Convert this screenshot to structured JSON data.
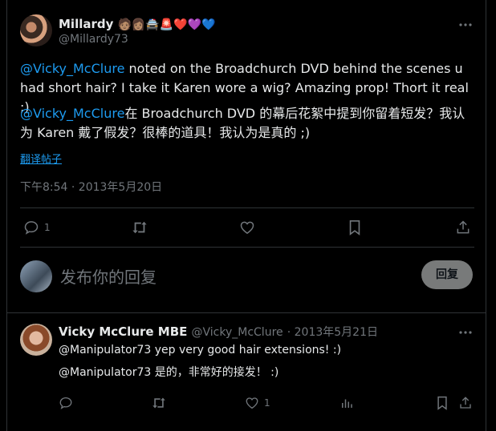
{
  "colors": {
    "background": "#000000",
    "text": "#e7e9ea",
    "muted": "#71767b",
    "accent": "#1d9bf0",
    "divider": "#2f3336"
  },
  "main_tweet": {
    "display_name": "Millardy",
    "name_emojis": "🧑🏽👩🏽🚔🚨❤️💜💙",
    "handle": "@Millardy73",
    "more_icon": "more-dots-icon",
    "text_en": {
      "mention": "@Vicky_McClure",
      "rest": " noted on the Broadchurch DVD behind the scenes u had short hair? I take it Karen wore a wig? Amazing prop! Thort it real ;)"
    },
    "text_zh": {
      "mention": "@Vicky_McClure",
      "rest": "在 Broadchurch DVD 的幕后花絮中提到你留着短发？我认为 Karen 戴了假发？很棒的道具！我认为是真的 ;)"
    },
    "translate_link": "翻译帖子",
    "timestamp": "下午8:54 · 2013年5月20日",
    "actions": {
      "reply_count": "1",
      "retweet_count": "",
      "like_count": "",
      "bookmark_count": ""
    }
  },
  "reply_box": {
    "placeholder": "发布你的回复",
    "button": "回复"
  },
  "reply_tweet": {
    "display_name": "Vicky McClure MBE",
    "handle": "@Vicky_McClure",
    "date": "· 2013年5月21日",
    "text_en": "@Manipulator73 yep very good hair extensions! :)",
    "text_zh": "@Manipulator73 是的，非常好的接发！ :)",
    "actions": {
      "reply_count": "",
      "retweet_count": "",
      "like_count": "1",
      "views_count": ""
    }
  }
}
